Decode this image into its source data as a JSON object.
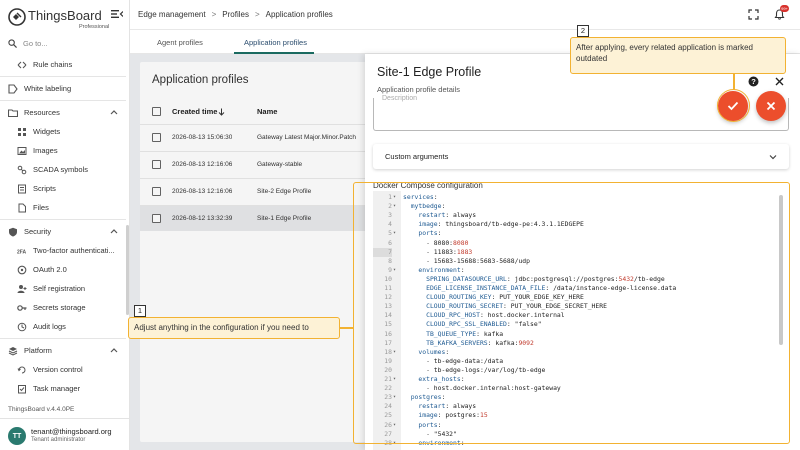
{
  "brand": {
    "name": "ThingsBoard",
    "edition": "Professional",
    "version": "ThingsBoard v.4.4.0PE"
  },
  "search": {
    "placeholder": "Go to..."
  },
  "sidebar": {
    "items": [
      {
        "label": "Rule chains",
        "icon": "rule-chain-icon",
        "level": "sub"
      },
      {
        "label": "White labeling",
        "icon": "white-label-icon",
        "level": "top"
      },
      {
        "label": "Resources",
        "icon": "folder-icon",
        "level": "group"
      },
      {
        "label": "Widgets",
        "icon": "widgets-icon",
        "level": "sub"
      },
      {
        "label": "Images",
        "icon": "image-icon",
        "level": "sub"
      },
      {
        "label": "SCADA symbols",
        "icon": "scada-icon",
        "level": "sub"
      },
      {
        "label": "Scripts",
        "icon": "script-icon",
        "level": "sub"
      },
      {
        "label": "Files",
        "icon": "file-icon",
        "level": "sub"
      },
      {
        "label": "Security",
        "icon": "shield-icon",
        "level": "group"
      },
      {
        "label": "Two-factor authenticati...",
        "icon": "two-factor-icon",
        "level": "sub"
      },
      {
        "label": "OAuth 2.0",
        "icon": "oauth-icon",
        "level": "sub"
      },
      {
        "label": "Self registration",
        "icon": "self-registration-icon",
        "level": "sub"
      },
      {
        "label": "Secrets storage",
        "icon": "key-icon",
        "level": "sub"
      },
      {
        "label": "Audit logs",
        "icon": "audit-log-icon",
        "level": "sub"
      },
      {
        "label": "Platform",
        "icon": "platform-icon",
        "level": "group"
      },
      {
        "label": "Version control",
        "icon": "version-control-icon",
        "level": "sub"
      },
      {
        "label": "Task manager",
        "icon": "task-manager-icon",
        "level": "sub"
      }
    ]
  },
  "user": {
    "initials": "TT",
    "email": "tenant@thingsboard.org",
    "role": "Tenant administrator"
  },
  "breadcrumb": [
    "Edge management",
    "Profiles",
    "Application profiles"
  ],
  "header": {
    "notification_count": "99+"
  },
  "tabs": [
    {
      "label": "Agent profiles",
      "active": false
    },
    {
      "label": "Application profiles",
      "active": true
    }
  ],
  "list": {
    "title": "Application profiles",
    "columns": [
      "Created time",
      "Name"
    ],
    "rows": [
      {
        "time": "2026-08-13 15:06:30",
        "name": "Gateway Latest Major.Minor.Patch",
        "selected": false
      },
      {
        "time": "2026-08-13 12:16:06",
        "name": "Gateway-stable",
        "selected": false
      },
      {
        "time": "2026-08-13 12:16:06",
        "name": "Site-2 Edge Profile",
        "selected": false
      },
      {
        "time": "2026-08-12 13:32:39",
        "name": "Site-1 Edge Profile",
        "selected": true
      }
    ]
  },
  "detail": {
    "title": "Site-1 Edge Profile",
    "subtitle": "Application profile details",
    "textbox_ghost": "Description",
    "custom_arguments": "Custom arguments",
    "docker_label": "Docker Compose configuration"
  },
  "code_lines": [
    {
      "n": "1",
      "fold": true,
      "t": "services:"
    },
    {
      "n": "2",
      "fold": true,
      "t": "  mytbedge:"
    },
    {
      "n": "3",
      "fold": false,
      "t": "    restart: always"
    },
    {
      "n": "4",
      "fold": false,
      "t": "    image: thingsboard/tb-edge-pe:4.3.1.1EDGEPE"
    },
    {
      "n": "5",
      "fold": true,
      "t": "    ports:"
    },
    {
      "n": "6",
      "fold": false,
      "t": "      - 8080:8080"
    },
    {
      "n": "7",
      "fold": false,
      "t": "      - 11883:1883",
      "hl": true
    },
    {
      "n": "8",
      "fold": false,
      "t": "      - 15683-15688:5683-5688/udp"
    },
    {
      "n": "9",
      "fold": true,
      "t": "    environment:"
    },
    {
      "n": "10",
      "fold": false,
      "t": "      SPRING_DATASOURCE_URL: jdbc:postgresql://postgres:5432/tb-edge"
    },
    {
      "n": "11",
      "fold": false,
      "t": "      EDGE_LICENSE_INSTANCE_DATA_FILE: /data/instance-edge-license.data"
    },
    {
      "n": "12",
      "fold": false,
      "t": "      CLOUD_ROUTING_KEY: PUT_YOUR_EDGE_KEY_HERE"
    },
    {
      "n": "13",
      "fold": false,
      "t": "      CLOUD_ROUTING_SECRET: PUT_YOUR_EDGE_SECRET_HERE"
    },
    {
      "n": "14",
      "fold": false,
      "t": "      CLOUD_RPC_HOST: host.docker.internal"
    },
    {
      "n": "15",
      "fold": false,
      "t": "      CLOUD_RPC_SSL_ENABLED: \"false\""
    },
    {
      "n": "16",
      "fold": false,
      "t": "      TB_QUEUE_TYPE: kafka"
    },
    {
      "n": "17",
      "fold": false,
      "t": "      TB_KAFKA_SERVERS: kafka:9092"
    },
    {
      "n": "18",
      "fold": true,
      "t": "    volumes:"
    },
    {
      "n": "19",
      "fold": false,
      "t": "      - tb-edge-data:/data"
    },
    {
      "n": "20",
      "fold": false,
      "t": "      - tb-edge-logs:/var/log/tb-edge"
    },
    {
      "n": "21",
      "fold": true,
      "t": "    extra_hosts:"
    },
    {
      "n": "22",
      "fold": false,
      "t": "      - host.docker.internal:host-gateway"
    },
    {
      "n": "23",
      "fold": true,
      "t": "  postgres:"
    },
    {
      "n": "24",
      "fold": false,
      "t": "    restart: always"
    },
    {
      "n": "25",
      "fold": false,
      "t": "    image: postgres:15"
    },
    {
      "n": "26",
      "fold": true,
      "t": "    ports:"
    },
    {
      "n": "27",
      "fold": false,
      "t": "      - \"5432\""
    },
    {
      "n": "28",
      "fold": true,
      "t": "    environment:"
    }
  ],
  "callouts": {
    "c1": {
      "step": "1",
      "text": "Adjust anything in the configuration if you need to"
    },
    "c2": {
      "step": "2",
      "text": "After applying, every related application is marked outdated"
    }
  },
  "colors": {
    "accent": "#ec4e2c",
    "highlight": "#f2b232",
    "brand": "#1a6a60"
  }
}
